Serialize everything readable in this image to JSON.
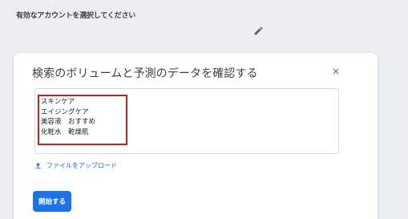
{
  "page": {
    "notice": "有効なアカウントを選択してください"
  },
  "dialog": {
    "title": "検索のボリュームと予測のデータを確認する",
    "keywords": [
      "スキンケア",
      "エイジングケア",
      "美容液　おすすめ",
      "化粧水　乾燥肌"
    ],
    "upload_label": "ファイルをアップロード",
    "start_label": "開始する"
  },
  "icons": {
    "edit": "pencil-icon",
    "close": "close-icon",
    "upload": "upload-icon"
  },
  "colors": {
    "accent": "#1a73e8",
    "highlight": "#c5221f",
    "background": "#eceef1"
  }
}
